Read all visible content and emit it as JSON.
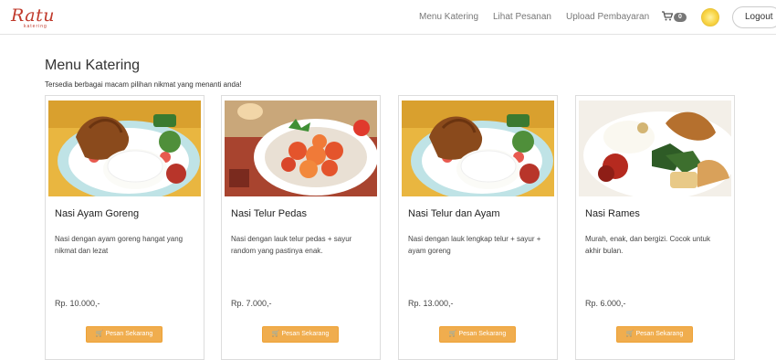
{
  "navbar": {
    "brand": "Ratu",
    "brand_sub": "katering",
    "links": [
      "Menu Katering",
      "Lihat Pesanan",
      "Upload Pembayaran"
    ],
    "cart_icon": "cart-icon",
    "cart_count": "0",
    "logout_label": "Logout"
  },
  "page": {
    "title": "Menu Katering",
    "subtitle": "Tersedia berbagai macam pilihan nikmat yang menanti anda!"
  },
  "cards": [
    {
      "title": "Nasi Ayam Goreng",
      "desc": "Nasi dengan ayam goreng hangat yang nikmat dan lezat",
      "price": "Rp. 10.000,-",
      "button": "Pesan Sekarang",
      "image": "fried-chicken-rice-photo"
    },
    {
      "title": "Nasi Telur Pedas",
      "desc": "Nasi dengan lauk telur pedas + sayur random yang pastinya enak.",
      "price": "Rp. 7.000,-",
      "button": "Pesan Sekarang",
      "image": "spicy-egg-photo"
    },
    {
      "title": "Nasi Telur dan Ayam",
      "desc": "Nasi dengan lauk lengkap telur + sayur + ayam goreng",
      "price": "Rp. 13.000,-",
      "button": "Pesan Sekarang",
      "image": "fried-chicken-rice-photo"
    },
    {
      "title": "Nasi Rames",
      "desc": "Murah, enak, dan bergizi. Cocok untuk akhir bulan.",
      "price": "Rp. 6.000,-",
      "button": "Pesan Sekarang",
      "image": "nasi-rames-photo"
    }
  ],
  "colors": {
    "accent": "#f0ad4e",
    "brand": "#c0392b"
  }
}
